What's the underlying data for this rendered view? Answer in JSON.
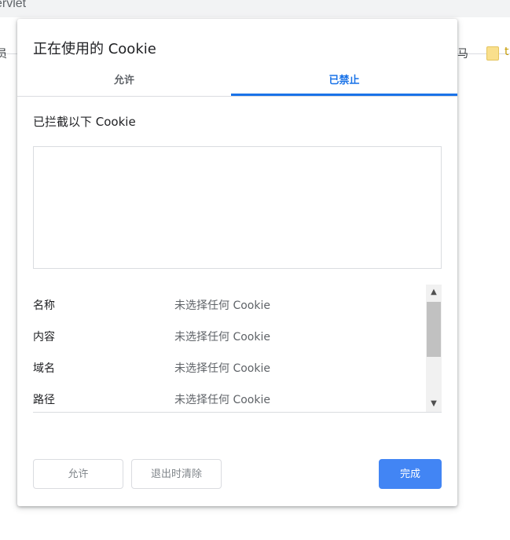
{
  "background": {
    "tab_title": "ervlet",
    "bookmark_left": "员",
    "bookmark_right": "马",
    "bookmark_folder": "t"
  },
  "dialog": {
    "title": "正在使用的 Cookie",
    "tabs": [
      {
        "label": "允许",
        "active": false
      },
      {
        "label": "已禁止",
        "active": true
      }
    ],
    "section_label": "已拦截以下 Cookie",
    "details": [
      {
        "key": "名称",
        "value": "未选择任何 Cookie"
      },
      {
        "key": "内容",
        "value": "未选择任何 Cookie"
      },
      {
        "key": "域名",
        "value": "未选择任何 Cookie"
      },
      {
        "key": "路径",
        "value": "未选择任何 Cookie"
      }
    ],
    "buttons": {
      "allow": "允许",
      "clear_on_exit": "退出时清除",
      "done": "完成"
    }
  },
  "colors": {
    "accent": "#1a73e8",
    "primary_button": "#4285f4"
  }
}
